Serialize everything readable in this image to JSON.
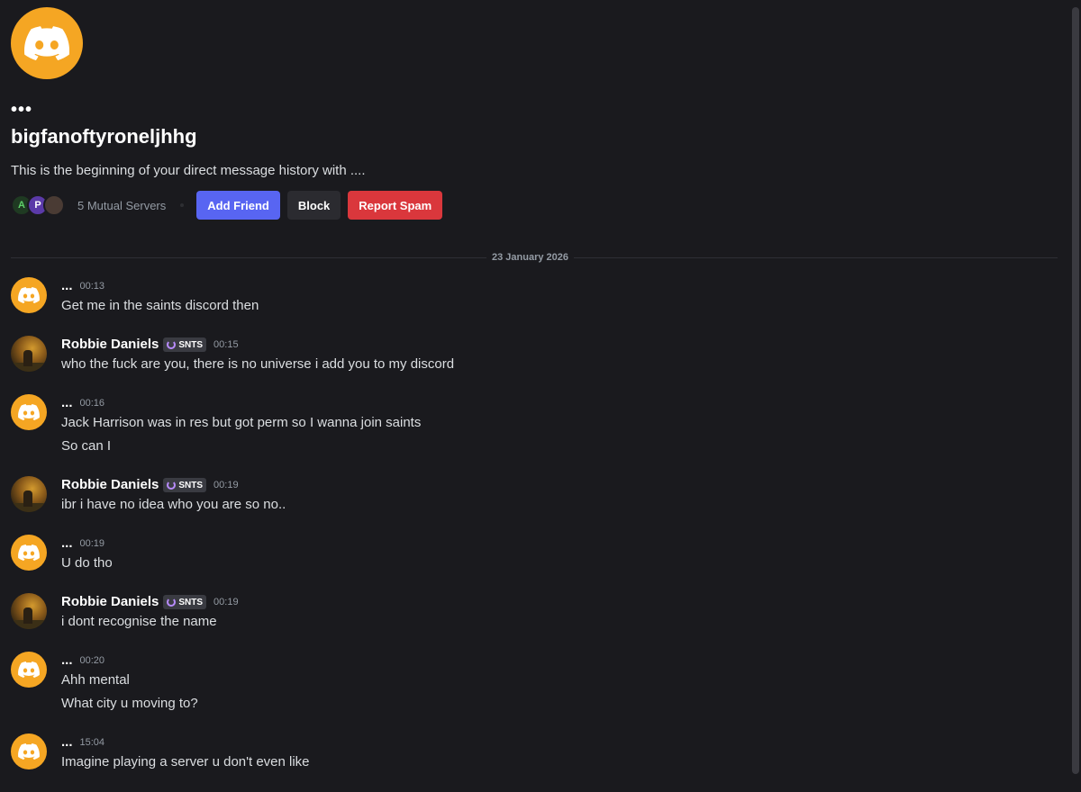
{
  "profile": {
    "display_name": "•••",
    "username": "bigfanoftyroneljhhg",
    "intro": "This is the beginning of your direct message history with ....",
    "mutual_servers": "5 Mutual Servers",
    "server_icons": [
      "A",
      "P",
      ""
    ]
  },
  "actions": {
    "add_friend": "Add Friend",
    "block": "Block",
    "report_spam": "Report Spam"
  },
  "divider": {
    "date": "23 January 2026"
  },
  "messages": [
    {
      "author": "...",
      "tag": "",
      "time": "00:13",
      "avatar": "discord",
      "lines": [
        "Get me in the saints discord then"
      ]
    },
    {
      "author": "Robbie Daniels",
      "tag": "SNTS",
      "time": "00:15",
      "avatar": "photo",
      "lines": [
        "who the fuck are you, there is no universe i add you to my discord"
      ]
    },
    {
      "author": "...",
      "tag": "",
      "time": "00:16",
      "avatar": "discord",
      "lines": [
        "Jack Harrison was in res but got perm so I wanna join saints",
        "So can I"
      ]
    },
    {
      "author": "Robbie Daniels",
      "tag": "SNTS",
      "time": "00:19",
      "avatar": "photo",
      "lines": [
        "ibr i have no idea who you are so no.."
      ]
    },
    {
      "author": "...",
      "tag": "",
      "time": "00:19",
      "avatar": "discord",
      "lines": [
        "U do tho"
      ]
    },
    {
      "author": "Robbie Daniels",
      "tag": "SNTS",
      "time": "00:19",
      "avatar": "photo",
      "lines": [
        "i dont recognise the name"
      ]
    },
    {
      "author": "...",
      "tag": "",
      "time": "00:20",
      "avatar": "discord",
      "lines": [
        "Ahh mental",
        "What city u moving to?"
      ]
    },
    {
      "author": "...",
      "tag": "",
      "time": "15:04",
      "avatar": "discord",
      "lines": [
        "Imagine playing a server u don't even like"
      ]
    }
  ],
  "colors": {
    "background": "#1a1a1e",
    "avatar_orange": "#f5a623",
    "blurple": "#5865f2",
    "danger": "#da373c"
  }
}
